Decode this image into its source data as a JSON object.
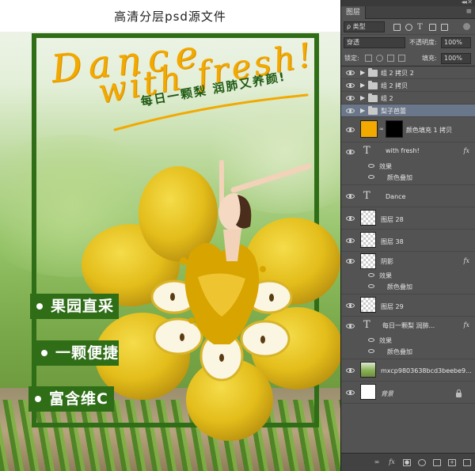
{
  "poster": {
    "top_title": "高清分层psd源文件",
    "headline_line1": "Dance",
    "headline_line2": "with fresh!",
    "slogan": "每日一颗梨  润肺又养颜!",
    "badges": [
      "果园直采",
      "一颗便捷",
      "富含维C"
    ],
    "colors": {
      "frame": "#2f6d17",
      "headline": "#f2a900",
      "pear": "#e8c21e",
      "juice": "#d8a400"
    }
  },
  "panel": {
    "tab": "图层",
    "filter_kind": "ρ 类型",
    "blend_mode": "穿透",
    "opacity_label": "不透明度:",
    "opacity_value": "100%",
    "lock_label": "锁定:",
    "fill_label": "填充:",
    "fill_value": "100%",
    "layers": [
      {
        "name": "组 2 拷贝 2",
        "type": "group",
        "selected": false
      },
      {
        "name": "组 2 拷贝",
        "type": "group",
        "selected": false
      },
      {
        "name": "组 2",
        "type": "group",
        "selected": false
      },
      {
        "name": "梨子芭蕾",
        "type": "group",
        "selected": true
      },
      {
        "name": "颜色填充 1 拷贝",
        "type": "fill"
      },
      {
        "name": "with fresh!",
        "type": "text",
        "fx": "fx",
        "effects_label": "效果",
        "effect": "颜色叠加"
      },
      {
        "name": "Dance",
        "type": "text"
      },
      {
        "name": "图层 28",
        "type": "image"
      },
      {
        "name": "图层 38",
        "type": "image"
      },
      {
        "name": "阴影",
        "type": "image",
        "fx": "fx",
        "effects_label": "效果",
        "effect": "颜色叠加"
      },
      {
        "name": "图层 29",
        "type": "image"
      },
      {
        "name": "每日一颗梨  润肺...",
        "type": "text",
        "fx": "fx",
        "effects_label": "效果",
        "effect": "颜色叠加"
      },
      {
        "name": "mxcp9803638bcd3beebe9...",
        "type": "image"
      },
      {
        "name": "背景",
        "type": "background"
      }
    ]
  }
}
